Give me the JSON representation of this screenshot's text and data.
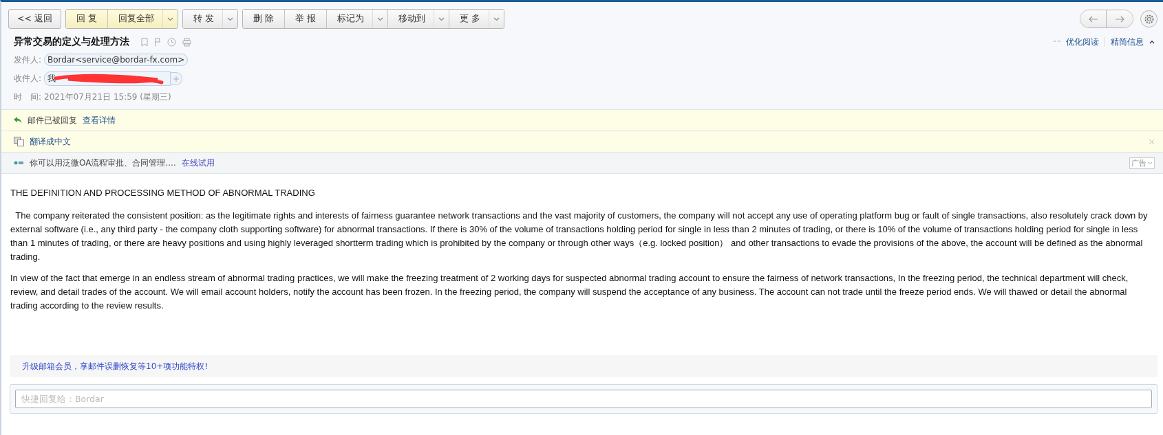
{
  "toolbar": {
    "back": "<< 返回",
    "groups": [
      {
        "kind": "primary",
        "buttons": [
          {
            "label": "回 复",
            "dropdown": false
          },
          {
            "label": "回复全部",
            "dropdown": true
          }
        ]
      },
      {
        "kind": "normal",
        "buttons": [
          {
            "label": "转 发",
            "dropdown": true
          }
        ]
      },
      {
        "kind": "normal",
        "buttons": [
          {
            "label": "删 除",
            "dropdown": false
          },
          {
            "label": "举 报",
            "dropdown": false
          },
          {
            "label": "标记为",
            "dropdown": true
          },
          {
            "label": "移动到",
            "dropdown": true
          },
          {
            "label": "更 多",
            "dropdown": true
          }
        ]
      }
    ]
  },
  "header": {
    "subject": "异常交易的定义与处理方法",
    "from_label": "发件人:",
    "from": "Bordar<service@bordar-fx.com>",
    "to_label": "收件人:",
    "to": "我",
    "time_label": "时　间:",
    "time": "2021年07月21日 15:59 (星期三)",
    "links": [
      "优化阅读",
      "精简信息"
    ]
  },
  "notices": [
    {
      "kind": "replied",
      "text": "邮件已被回复",
      "link": "查看详情"
    },
    {
      "kind": "translate",
      "link": "翻译成中文"
    },
    {
      "kind": "ad",
      "text": "你可以用泛微OA流程审批、合同管理....",
      "link": "在线试用",
      "tag": "广告"
    }
  ],
  "body": {
    "title": "THE DEFINITION AND PROCESSING METHOD OF ABNORMAL TRADING",
    "paragraphs": [
      "  The company reiterated the consistent position: as the legitimate rights and interests of fairness guarantee network transactions and the vast majority of customers, the company will not accept any use of operating platform bug or fault of single transactions, also resolutely crack down by external software (i.e., any third party - the company cloth supporting software) for abnormal transactions. If there is 30% of the volume of transactions holding period for single in less than 2 minutes of trading, or there is 10% of the volume of transactions holding period for single in less than 1 minutes of trading, or there are heavy positions and using highly leveraged shortterm trading which is prohibited by the company or through other ways（e.g. locked position） and other transactions to evade the provisions of the above, the account will be defined as the abnormal trading.",
      "In view of the fact that emerge in an endless stream of abnormal trading practices, we will make the freezing treatment of 2 working days for suspected abnormal trading account to ensure the fairness of network transactions, In the freezing period, the technical department will check, review, and detail trades of the account. We will email account holders, notify the account has been frozen. In the freezing period, the company will suspend the acceptance of any business. The account can not trade until the freeze period ends. We will thawed or detail the abnormal trading according to the review results."
    ]
  },
  "promo": "升级邮箱会员，享邮件误删恢复等10+项功能特权!",
  "quick_reply": {
    "placeholder": "快捷回复给：Bordar"
  }
}
